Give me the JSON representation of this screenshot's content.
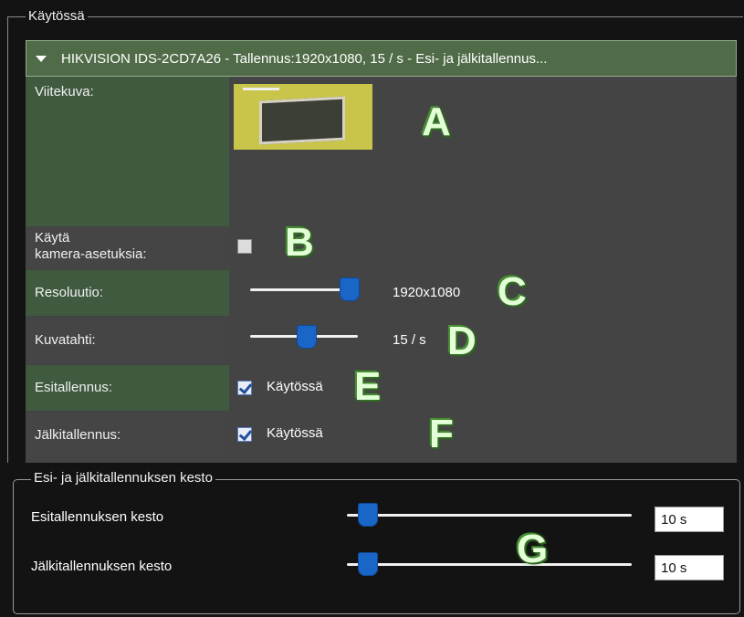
{
  "top_group": {
    "legend": "Käytössä",
    "camera_header": "HIKVISION IDS-2CD7A26 - Tallennus:1920x1080, 15 / s - Esi- ja jälkitallennus..."
  },
  "rows": {
    "reference_image_label": "Viitekuva:",
    "use_camera_settings_label_1": "Käytä",
    "use_camera_settings_label_2": "kamera-asetuksia:",
    "resolution_label": "Resoluutio:",
    "resolution_value": "1920x1080",
    "resolution_slider_fraction": 1.0,
    "framerate_label": "Kuvatahti:",
    "framerate_value": "15 / s",
    "framerate_slider_fraction": 0.55,
    "prerecord_label": "Esitallennus:",
    "prerecord_checkbox_label": "Käytössä",
    "postrecord_label": "Jälkitallennus:",
    "postrecord_checkbox_label": "Käytössä"
  },
  "annotations": {
    "a": "A",
    "b": "B",
    "c": "C",
    "d": "D",
    "e": "E",
    "f": "F",
    "g": "G"
  },
  "bottom_group": {
    "legend": "Esi- ja jälkitallennuksen kesto",
    "pre_duration_label": "Esitallennuksen kesto",
    "pre_duration_value": "10 s",
    "post_duration_label": "Jälkitallennuksen kesto",
    "post_duration_value": "10 s"
  }
}
